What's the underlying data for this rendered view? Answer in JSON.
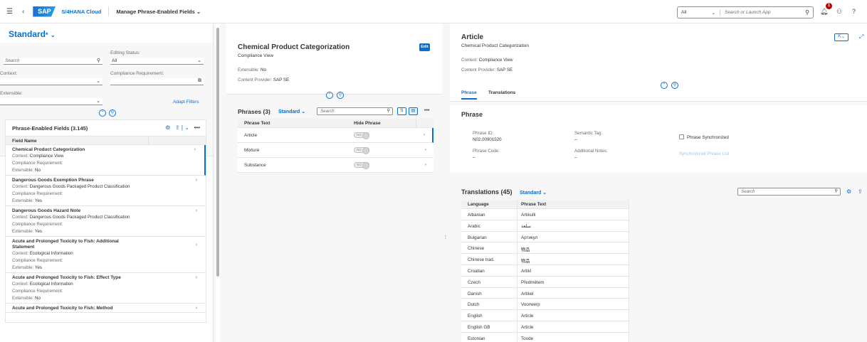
{
  "shell": {
    "product": "S/4HANA Cloud",
    "app_title": "Manage Phrase-Enabled Fields",
    "logo": "SAP",
    "search_scope": "All",
    "search_placeholder": "Search or Launch App",
    "notification_count": "1"
  },
  "list": {
    "variant": "Standard",
    "filters": {
      "search_placeholder": "Search",
      "editing_status_label": "Editing Status:",
      "editing_status_value": "All",
      "context_label": "Context:",
      "compliance_label": "Compliance Requirement:",
      "extensible_label": "Extensible:",
      "adapt_filters": "Adapt Filters"
    },
    "table_title": "Phrase-Enabled Fields (3.145)",
    "column_header": "Field Name",
    "context_key": "Context:",
    "compliance_key": "Compliance Requirement:",
    "extensible_key": "Extensible:",
    "rows": [
      {
        "name": "Chemical Product Categorization",
        "context": "Compliance View",
        "compliance": "",
        "extensible": "No"
      },
      {
        "name": "Dangerous Goods Exemption Phrase",
        "context": "Dangerous Goods Packaged Product Classification",
        "compliance": "",
        "extensible": "Yes"
      },
      {
        "name": "Dangerous Goods Hazard Note",
        "context": "Dangerous Goods Packaged Product Classification",
        "compliance": "",
        "extensible": "Yes"
      },
      {
        "name": "Acute and Prolonged Toxicity to Fish: Additional Statement",
        "context": "Ecological Information",
        "compliance": "",
        "extensible": "Yes"
      },
      {
        "name": "Acute and Prolonged Toxicity to Fish: Effect Type",
        "context": "Ecological Information",
        "compliance": "",
        "extensible": "No"
      },
      {
        "name": "Acute and Prolonged Toxicity to Fish: Method",
        "context": "",
        "compliance": "",
        "extensible": ""
      }
    ]
  },
  "detail": {
    "title": "Chemical Product Categorization",
    "subtitle": "Compliance View",
    "edit": "Edit",
    "extensible_key": "Extensible:",
    "extensible_val": "No",
    "provider_key": "Content Provider:",
    "provider_val": "SAP SE",
    "phrases_title": "Phrases (3)",
    "phrases_variant": "Standard",
    "phrases_search": "Search",
    "col_phrase_text": "Phrase Text",
    "col_hide_phrase": "Hide Phrase",
    "toggle_off": "NO",
    "phrases": [
      "Article",
      "Mixture",
      "Substance"
    ]
  },
  "article": {
    "title": "Article",
    "subtitle": "Chemical Product Categorization",
    "context_key": "Context:",
    "context_val": "Compliance View",
    "provider_key": "Content Provider:",
    "provider_val": "SAP SE",
    "tab_phrase": "Phrase",
    "tab_translations": "Translations",
    "section_title": "Phrase",
    "phrase_id_key": "Phrase ID:",
    "phrase_id_val": "N02.00901520",
    "semantic_tag_key": "Semantic Tag:",
    "semantic_tag_val": "–",
    "phrase_sync": "Phrase Synchronized",
    "phrase_code_key": "Phrase Code:",
    "phrase_code_val": "–",
    "notes_key": "Additional Notes:",
    "notes_val": "–",
    "sync_link": "Synchronized Phrase List",
    "translations_title": "Translations (45)",
    "translations_variant": "Standard",
    "translations_search": "Search",
    "col_language": "Language",
    "col_text": "Phrase Text",
    "translations": [
      {
        "lang": "Albanian",
        "text": "Artikulli"
      },
      {
        "lang": "Arabic",
        "text": "سلعة"
      },
      {
        "lang": "Bulgarian",
        "text": "Артикул"
      },
      {
        "lang": "Chinese",
        "text": "物品"
      },
      {
        "lang": "Chinese trad.",
        "text": "物品"
      },
      {
        "lang": "Croatian",
        "text": "Artikl"
      },
      {
        "lang": "Czech",
        "text": "Předmětem"
      },
      {
        "lang": "Danish",
        "text": "Artikel"
      },
      {
        "lang": "Dutch",
        "text": "Voorwerp"
      },
      {
        "lang": "English",
        "text": "Article"
      },
      {
        "lang": "English GB",
        "text": "Article"
      },
      {
        "lang": "Estonian",
        "text": "Toode"
      }
    ]
  }
}
